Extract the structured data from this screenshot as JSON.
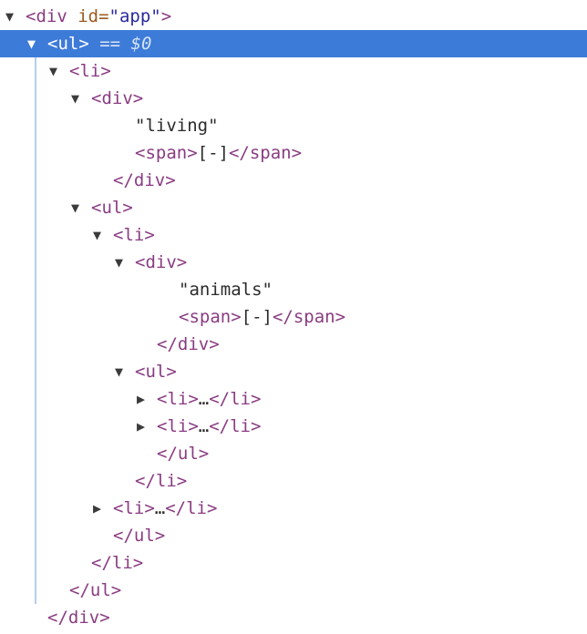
{
  "selection_marker": "== $0",
  "ellipsis": "…",
  "rows": [
    {
      "indent": 0,
      "arrow": "down",
      "open": "<div",
      "attr_name": " id=",
      "attr_value": "\"app\"",
      "close": ">",
      "text": "",
      "end": ""
    },
    {
      "indent": 1,
      "arrow": "down",
      "open": "<ul>",
      "attr_name": "",
      "attr_value": "",
      "close": "",
      "text": "",
      "end": "",
      "selected": true
    },
    {
      "indent": 2,
      "arrow": "down",
      "open": "<li>",
      "attr_name": "",
      "attr_value": "",
      "close": "",
      "text": "",
      "end": ""
    },
    {
      "indent": 3,
      "arrow": "down",
      "open": "<div>",
      "attr_name": "",
      "attr_value": "",
      "close": "",
      "text": "",
      "end": ""
    },
    {
      "indent": 5,
      "arrow": "none",
      "open": "",
      "attr_name": "",
      "attr_value": "",
      "close": "",
      "text": "\"living\"",
      "end": ""
    },
    {
      "indent": 5,
      "arrow": "none",
      "open": "<span>",
      "attr_name": "",
      "attr_value": "",
      "close": "",
      "text": "[-]",
      "end": "</span>"
    },
    {
      "indent": 4,
      "arrow": "none",
      "open": "</div>",
      "attr_name": "",
      "attr_value": "",
      "close": "",
      "text": "",
      "end": ""
    },
    {
      "indent": 3,
      "arrow": "down",
      "open": "<ul>",
      "attr_name": "",
      "attr_value": "",
      "close": "",
      "text": "",
      "end": ""
    },
    {
      "indent": 4,
      "arrow": "down",
      "open": "<li>",
      "attr_name": "",
      "attr_value": "",
      "close": "",
      "text": "",
      "end": ""
    },
    {
      "indent": 5,
      "arrow": "down",
      "open": "<div>",
      "attr_name": "",
      "attr_value": "",
      "close": "",
      "text": "",
      "end": ""
    },
    {
      "indent": 7,
      "arrow": "none",
      "open": "",
      "attr_name": "",
      "attr_value": "",
      "close": "",
      "text": "\"animals\"",
      "end": ""
    },
    {
      "indent": 7,
      "arrow": "none",
      "open": "<span>",
      "attr_name": "",
      "attr_value": "",
      "close": "",
      "text": "[-]",
      "end": "</span>"
    },
    {
      "indent": 6,
      "arrow": "none",
      "open": "</div>",
      "attr_name": "",
      "attr_value": "",
      "close": "",
      "text": "",
      "end": ""
    },
    {
      "indent": 5,
      "arrow": "down",
      "open": "<ul>",
      "attr_name": "",
      "attr_value": "",
      "close": "",
      "text": "",
      "end": ""
    },
    {
      "indent": 6,
      "arrow": "right",
      "open": "<li>",
      "attr_name": "",
      "attr_value": "",
      "close": "",
      "text": "…",
      "end": "</li>"
    },
    {
      "indent": 6,
      "arrow": "right",
      "open": "<li>",
      "attr_name": "",
      "attr_value": "",
      "close": "",
      "text": "…",
      "end": "</li>"
    },
    {
      "indent": 6,
      "arrow": "none",
      "open": "</ul>",
      "attr_name": "",
      "attr_value": "",
      "close": "",
      "text": "",
      "end": ""
    },
    {
      "indent": 5,
      "arrow": "none",
      "open": "</li>",
      "attr_name": "",
      "attr_value": "",
      "close": "",
      "text": "",
      "end": ""
    },
    {
      "indent": 4,
      "arrow": "right",
      "open": "<li>",
      "attr_name": "",
      "attr_value": "",
      "close": "",
      "text": "…",
      "end": "</li>"
    },
    {
      "indent": 4,
      "arrow": "none",
      "open": "</ul>",
      "attr_name": "",
      "attr_value": "",
      "close": "",
      "text": "",
      "end": ""
    },
    {
      "indent": 3,
      "arrow": "none",
      "open": "</li>",
      "attr_name": "",
      "attr_value": "",
      "close": "",
      "text": "",
      "end": ""
    },
    {
      "indent": 2,
      "arrow": "none",
      "open": "</ul>",
      "attr_name": "",
      "attr_value": "",
      "close": "",
      "text": "",
      "end": ""
    },
    {
      "indent": 1,
      "arrow": "none",
      "open": "</div>",
      "attr_name": "",
      "attr_value": "",
      "close": "",
      "text": "",
      "end": ""
    }
  ]
}
